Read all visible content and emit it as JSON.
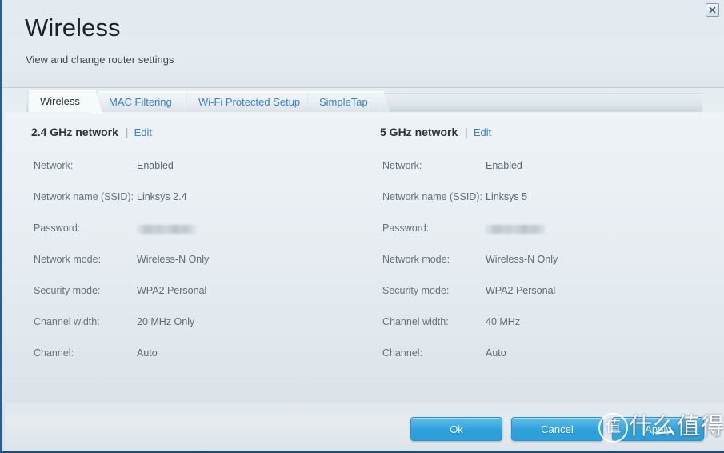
{
  "window": {
    "title": "Wireless",
    "subtitle": "View and change router settings",
    "close_icon": "close-icon",
    "accent_color": "#2ba0dc",
    "link_color": "#3b82c4"
  },
  "tabs": [
    {
      "label": "Wireless",
      "active": true
    },
    {
      "label": "MAC Filtering",
      "active": false
    },
    {
      "label": "Wi-Fi Protected Setup",
      "active": false
    },
    {
      "label": "SimpleTap",
      "active": false
    }
  ],
  "columns": [
    {
      "heading": "2.4 GHz network",
      "separator": "|",
      "edit_label": "Edit",
      "fields": [
        {
          "label": "Network:",
          "value": "Enabled",
          "masked": false
        },
        {
          "label": "Network name (SSID):",
          "value": "Linksys 2.4",
          "masked": false
        },
        {
          "label": "Password:",
          "value": "",
          "masked": true
        },
        {
          "label": "Network mode:",
          "value": "Wireless-N Only",
          "masked": false
        },
        {
          "label": "Security mode:",
          "value": "WPA2 Personal",
          "masked": false
        },
        {
          "label": "Channel width:",
          "value": "20 MHz Only",
          "masked": false
        },
        {
          "label": "Channel:",
          "value": "Auto",
          "masked": false
        }
      ]
    },
    {
      "heading": "5 GHz network",
      "separator": "|",
      "edit_label": "Edit",
      "fields": [
        {
          "label": "Network:",
          "value": "Enabled",
          "masked": false
        },
        {
          "label": "Network name (SSID):",
          "value": "Linksys 5",
          "masked": false
        },
        {
          "label": "Password:",
          "value": "",
          "masked": true
        },
        {
          "label": "Network mode:",
          "value": "Wireless-N Only",
          "masked": false
        },
        {
          "label": "Security mode:",
          "value": "WPA2 Personal",
          "masked": false
        },
        {
          "label": "Channel width:",
          "value": "40 MHz",
          "masked": false
        },
        {
          "label": "Channel:",
          "value": "Auto",
          "masked": false
        }
      ]
    }
  ],
  "footer": {
    "ok_label": "Ok",
    "cancel_label": "Cancel",
    "apply_label": "Apply"
  },
  "watermark": {
    "badge": "值",
    "text": "什么值得买"
  }
}
